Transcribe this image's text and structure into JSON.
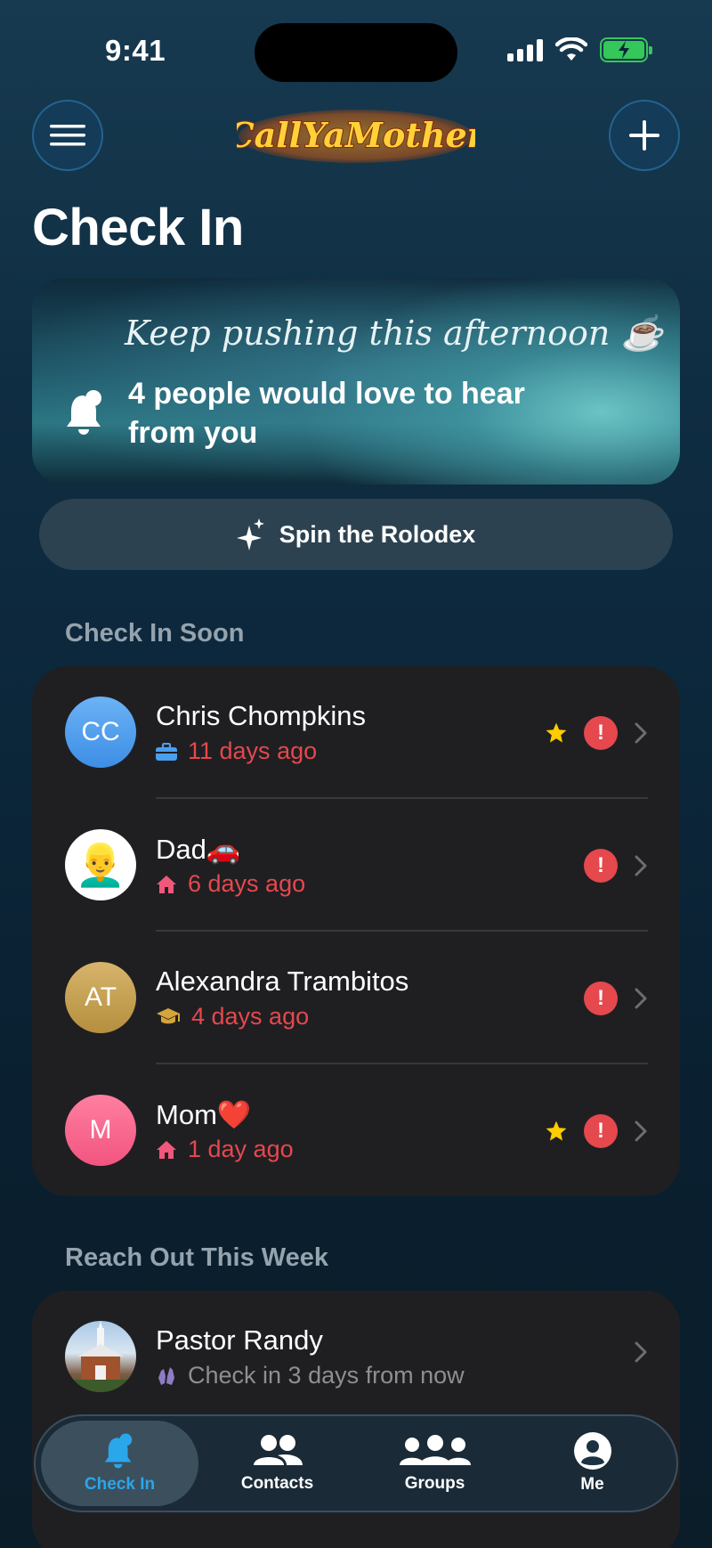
{
  "status_bar": {
    "time": "9:41"
  },
  "header": {
    "app_name": "Call Ya Mother",
    "page_title": "Check In"
  },
  "hero": {
    "tagline": "Keep pushing this afternoon ☕",
    "message": "4 people would love to hear from you"
  },
  "spin_button": {
    "label": "Spin the Rolodex"
  },
  "sections": {
    "soon": {
      "title": "Check In Soon",
      "rows": [
        {
          "name": "Chris Chompkins",
          "initials": "CC",
          "sub": "11 days ago",
          "category_icon": "briefcase-icon",
          "starred": true,
          "overdue": true
        },
        {
          "name": "Dad🚗",
          "initials": "",
          "sub": "6 days ago",
          "category_icon": "house-icon",
          "starred": false,
          "overdue": true
        },
        {
          "name": "Alexandra Trambitos",
          "initials": "AT",
          "sub": "4 days ago",
          "category_icon": "graduation-cap-icon",
          "starred": false,
          "overdue": true
        },
        {
          "name": "Mom❤️",
          "initials": "M",
          "sub": "1 day ago",
          "category_icon": "house-icon",
          "starred": true,
          "overdue": true
        }
      ]
    },
    "week": {
      "title": "Reach Out This Week",
      "rows": [
        {
          "name": "Pastor Randy",
          "sub": "Check in 3 days from now",
          "category_icon": "praying-hands-icon"
        }
      ]
    }
  },
  "tabbar": {
    "tabs": [
      {
        "label": "Check In",
        "active": true
      },
      {
        "label": "Contacts",
        "active": false
      },
      {
        "label": "Groups",
        "active": false
      },
      {
        "label": "Me",
        "active": false
      }
    ]
  },
  "colors": {
    "accent": "#2aa6ea",
    "overdue": "#e5484d",
    "star": "#ffcc00",
    "card": "#1f1f22"
  }
}
